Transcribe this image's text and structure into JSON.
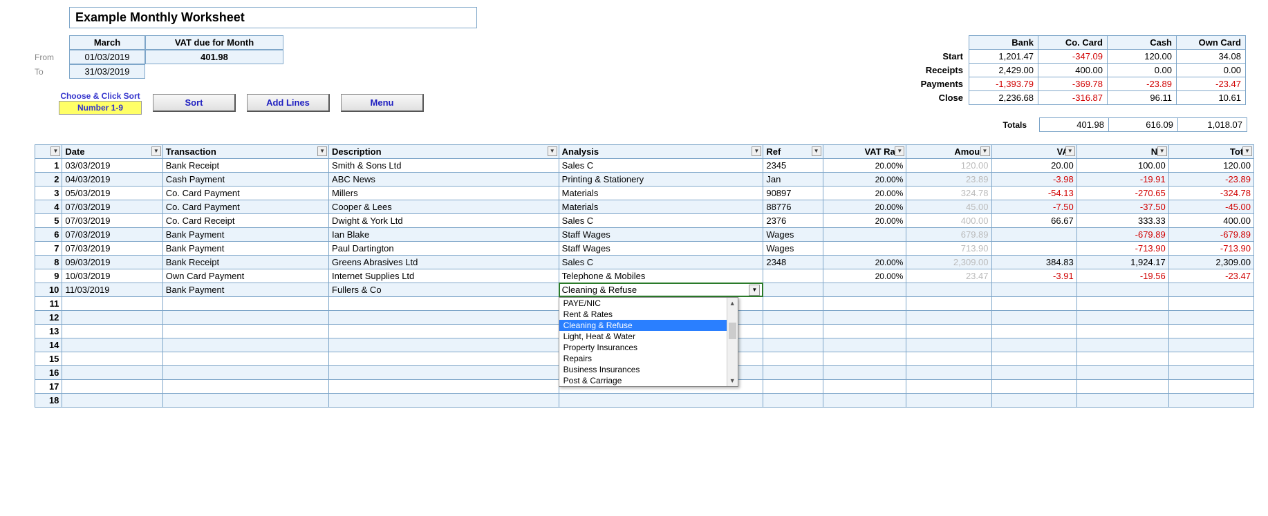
{
  "title": "Example Monthly Worksheet",
  "period": {
    "from_label": "From",
    "to_label": "To",
    "month_header": "March",
    "vat_header": "VAT due for Month",
    "from_date": "01/03/2019",
    "to_date": "31/03/2019",
    "vat_value": "401.98"
  },
  "controls": {
    "sort_hint": "Choose & Click Sort",
    "sort_range": "Number  1-9",
    "sort_btn": "Sort",
    "add_lines_btn": "Add Lines",
    "menu_btn": "Menu"
  },
  "summary": {
    "headers": {
      "bank": "Bank",
      "co_card": "Co. Card",
      "cash": "Cash",
      "own_card": "Own Card"
    },
    "rows": [
      {
        "label": "Start",
        "bank": "1,201.47",
        "co_card": "-347.09",
        "cash": "120.00",
        "own_card": "34.08",
        "neg": {
          "co_card": true
        }
      },
      {
        "label": "Receipts",
        "bank": "2,429.00",
        "co_card": "400.00",
        "cash": "0.00",
        "own_card": "0.00",
        "neg": {}
      },
      {
        "label": "Payments",
        "bank": "-1,393.79",
        "co_card": "-369.78",
        "cash": "-23.89",
        "own_card": "-23.47",
        "neg": {
          "bank": true,
          "co_card": true,
          "cash": true,
          "own_card": true
        }
      },
      {
        "label": "Close",
        "bank": "2,236.68",
        "co_card": "-316.87",
        "cash": "96.11",
        "own_card": "10.61",
        "neg": {
          "co_card": true
        }
      }
    ],
    "totals_label": "Totals",
    "totals": {
      "a": "401.98",
      "b": "616.09",
      "c": "1,018.07"
    }
  },
  "table": {
    "headers": {
      "num": "",
      "date": "Date",
      "transaction": "Transaction",
      "description": "Description",
      "analysis": "Analysis",
      "ref": "Ref",
      "vat_rate": "VAT Rate",
      "amount": "Amount",
      "vat": "VAT",
      "net": "Net",
      "total": "Total"
    },
    "rows": [
      {
        "n": "1",
        "date": "03/03/2019",
        "trans": "Bank Receipt",
        "desc": "Smith & Sons Ltd",
        "analysis": "Sales C",
        "ref": "2345",
        "rate": "20.00%",
        "amount": "120.00",
        "vat": "20.00",
        "net": "100.00",
        "total": "120.00",
        "neg": {}
      },
      {
        "n": "2",
        "date": "04/03/2019",
        "trans": "Cash Payment",
        "desc": "ABC News",
        "analysis": "Printing & Stationery",
        "ref": "Jan",
        "rate": "20.00%",
        "amount": "23.89",
        "vat": "-3.98",
        "net": "-19.91",
        "total": "-23.89",
        "neg": {
          "vat": true,
          "net": true,
          "total": true
        }
      },
      {
        "n": "3",
        "date": "05/03/2019",
        "trans": "Co. Card Payment",
        "desc": "Millers",
        "analysis": "Materials",
        "ref": "90897",
        "rate": "20.00%",
        "amount": "324.78",
        "vat": "-54.13",
        "net": "-270.65",
        "total": "-324.78",
        "neg": {
          "vat": true,
          "net": true,
          "total": true
        }
      },
      {
        "n": "4",
        "date": "07/03/2019",
        "trans": "Co. Card Payment",
        "desc": "Cooper & Lees",
        "analysis": "Materials",
        "ref": "88776",
        "rate": "20.00%",
        "amount": "45.00",
        "vat": "-7.50",
        "net": "-37.50",
        "total": "-45.00",
        "neg": {
          "vat": true,
          "net": true,
          "total": true
        }
      },
      {
        "n": "5",
        "date": "07/03/2019",
        "trans": "Co. Card Receipt",
        "desc": "Dwight & York Ltd",
        "analysis": "Sales C",
        "ref": "2376",
        "rate": "20.00%",
        "amount": "400.00",
        "vat": "66.67",
        "net": "333.33",
        "total": "400.00",
        "neg": {}
      },
      {
        "n": "6",
        "date": "07/03/2019",
        "trans": "Bank Payment",
        "desc": "Ian Blake",
        "analysis": "Staff Wages",
        "ref": "Wages",
        "rate": "",
        "amount": "679.89",
        "vat": "",
        "net": "-679.89",
        "total": "-679.89",
        "neg": {
          "net": true,
          "total": true
        }
      },
      {
        "n": "7",
        "date": "07/03/2019",
        "trans": "Bank Payment",
        "desc": "Paul Dartington",
        "analysis": "Staff Wages",
        "ref": "Wages",
        "rate": "",
        "amount": "713.90",
        "vat": "",
        "net": "-713.90",
        "total": "-713.90",
        "neg": {
          "net": true,
          "total": true
        }
      },
      {
        "n": "8",
        "date": "09/03/2019",
        "trans": "Bank Receipt",
        "desc": "Greens Abrasives Ltd",
        "analysis": "Sales C",
        "ref": "2348",
        "rate": "20.00%",
        "amount": "2,309.00",
        "vat": "384.83",
        "net": "1,924.17",
        "total": "2,309.00",
        "neg": {}
      },
      {
        "n": "9",
        "date": "10/03/2019",
        "trans": "Own Card Payment",
        "desc": "Internet Supplies Ltd",
        "analysis": "Telephone & Mobiles",
        "ref": "",
        "rate": "20.00%",
        "amount": "23.47",
        "vat": "-3.91",
        "net": "-19.56",
        "total": "-23.47",
        "neg": {
          "vat": true,
          "net": true,
          "total": true
        }
      }
    ],
    "active_row": {
      "n": "10",
      "date": "11/03/2019",
      "trans": "Bank Payment",
      "desc": "Fullers & Co",
      "analysis": "Cleaning & Refuse"
    },
    "empty_rows": [
      "11",
      "12",
      "13",
      "14",
      "15",
      "16",
      "17",
      "18"
    ]
  },
  "dropdown": {
    "options": [
      "PAYE/NIC",
      "Rent & Rates",
      "Cleaning & Refuse",
      "Light, Heat & Water",
      "Property Insurances",
      "Repairs",
      "Business Insurances",
      "Post & Carriage"
    ],
    "selected_index": 2
  }
}
